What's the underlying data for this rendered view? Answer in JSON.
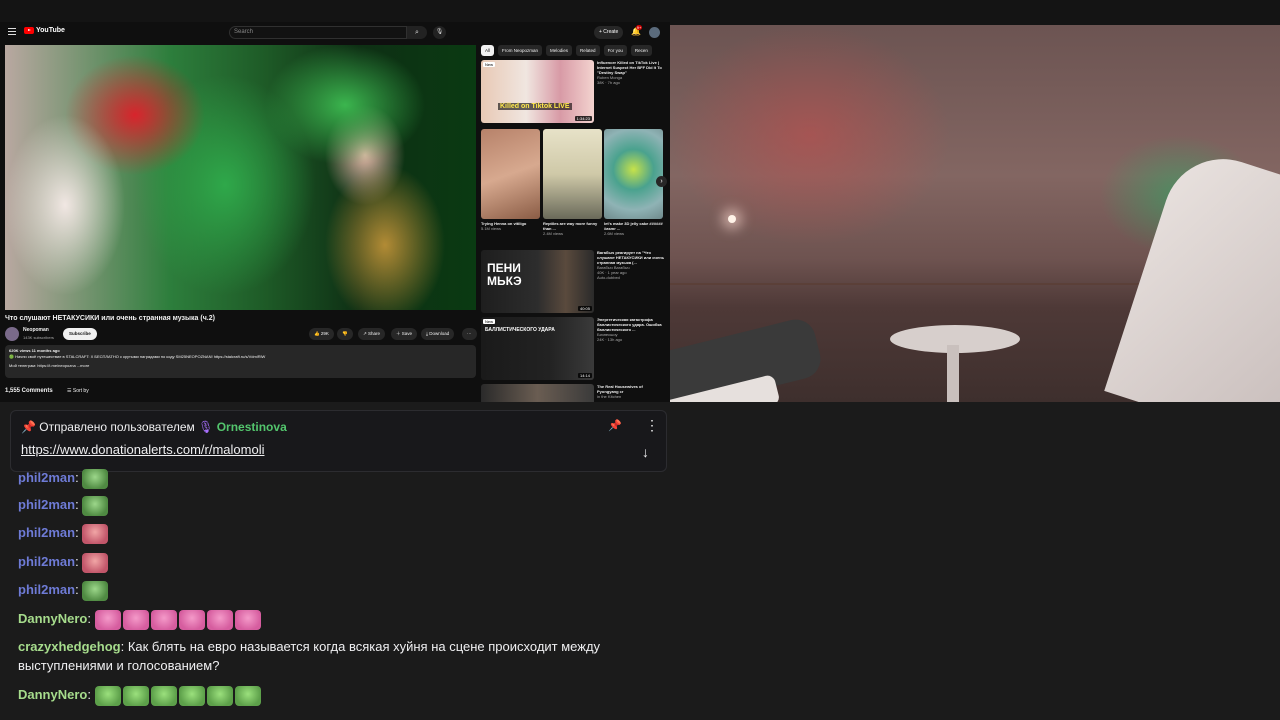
{
  "youtube": {
    "logo": "YouTube",
    "search_placeholder": "Search",
    "create_label": "+ Create",
    "bell_badge": "9+",
    "video": {
      "title": "Что слушают НЕТАКУСИКИ или очень странная музыка (ч.2)",
      "channel": "Neopoman",
      "subscribers": "143K subscribers",
      "subscribe_label": "Subscribe",
      "likes": "29K",
      "share_label": "Share",
      "save_label": "Save",
      "download_label": "Download",
      "views_date": "620K views  11 months ago",
      "desc_line1": "🟢 Начни своё путешествие в STALCRAFT: X БЕСПЛАТНО с крутыми наградами по коду SM25NEOPOZNAN! https://stalcraft.ru/s/VdmlRiW",
      "desc_line2": "Мой телеграм: https://t.me/neopozna   ...more",
      "comments": "1,555 Comments",
      "sort_label": "Sort by"
    },
    "chips": [
      "All",
      "From Neopozman",
      "Melodies",
      "Related",
      "For you",
      "Recen"
    ],
    "recommendations": [
      {
        "title": "Influencer Killed on TikTok Live | Internet Suspect Her BFF Did It To \"Destiny Swap\"",
        "channel": "Ruben Monga",
        "meta": "38K · 7h ago",
        "duration": "1:34:23",
        "thumb_text": "Killed on Tiktok LIVE",
        "badge": "New"
      },
      {
        "title": "Вагабыч реагирует на \"Что слушают НЕТАКУСИКИ или очень странная музыка (...",
        "channel": "Вагабыч Вагабыч",
        "meta": "40K · 1 year ago",
        "duration": "40:05",
        "thumb_text": "ПЕНИ МЬКЭ",
        "badge": "Auto-dubbed"
      },
      {
        "title": "Энергетическая катастрофа баллистического удара. Ошибка баллистического ...",
        "channel": "Бизнесшоу",
        "meta": "24K · 13h ago",
        "duration": "14:14",
        "thumb_text": "БАЛЛИСТИЧЕСКОГО УДАРА",
        "badge": "New"
      },
      {
        "title": "The Real Housewives of Pyongyang cr",
        "channel": "in the Kitchen",
        "meta": "",
        "duration": "",
        "thumb_text": "",
        "badge": ""
      }
    ],
    "shorts": [
      {
        "title": "Trying Henna on vitiligo",
        "meta": "5.1M views"
      },
      {
        "title": "Reptiles are way more funny than ...",
        "meta": "2.4M views"
      },
      {
        "title": "let's make 3D jelly cake ###### #asmr ...",
        "meta": "2.6M views"
      }
    ]
  },
  "pinned": {
    "prefix": "Отправлено пользователем",
    "user": "Ornestinova",
    "link": "https://www.donationalerts.com/r/malomoli"
  },
  "chat": {
    "messages": [
      {
        "user": "phil2man",
        "text": ""
      },
      {
        "user": "phil2man",
        "text": ""
      },
      {
        "user": "phil2man",
        "text": ""
      },
      {
        "user": "phil2man",
        "text": ""
      },
      {
        "user": "phil2man",
        "text": ""
      },
      {
        "user": "DannyNero",
        "text": ""
      },
      {
        "user": "crazyxhedgehog",
        "text": "Как блять на евро называется когда всякая хуйня на сцене происходит между",
        "text2": "выступлениями и голосованием?"
      },
      {
        "user": "DannyNero",
        "text": ""
      }
    ]
  },
  "colors": {
    "accent_purple": "#a970ff",
    "user_green": "#53c56d",
    "user_blue": "#6e7bd6",
    "yt_red": "#ff0000"
  }
}
